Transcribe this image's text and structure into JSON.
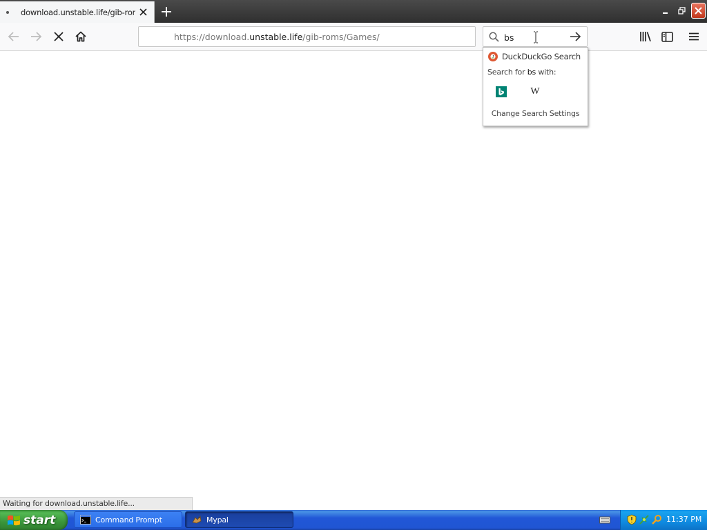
{
  "browser": {
    "tab": {
      "title": "download.unstable.life/gib-roms/G"
    },
    "url": {
      "prefix": "https://download.",
      "domain": "unstable.life",
      "path": "/gib-roms/Games/"
    },
    "search": {
      "value": "bs",
      "popup": {
        "default_engine": "DuckDuckGo Search",
        "search_for_prefix": "Search for",
        "search_term": "bs",
        "search_for_suffix": "with:",
        "engines": [
          "bing-icon",
          "wikipedia-icon"
        ],
        "wiki_glyph": "W",
        "change_settings": "Change Search Settings"
      }
    },
    "status": "Waiting for download.unstable.life..."
  },
  "taskbar": {
    "start_label": "start",
    "tasks": [
      {
        "label": "Command Prompt",
        "icon": "cmd-icon"
      },
      {
        "label": "Mypal",
        "icon": "mypal-icon"
      }
    ],
    "clock": "11:37 PM"
  },
  "colors": {
    "tab_bar": "#3a3a3a",
    "toolbar": "#f9f9fa",
    "start_green": "#3a953a",
    "taskbar_blue": "#2157d7",
    "tray_blue": "#0f8ae0",
    "ddg_orange": "#de5833",
    "bing_teal": "#008373"
  }
}
